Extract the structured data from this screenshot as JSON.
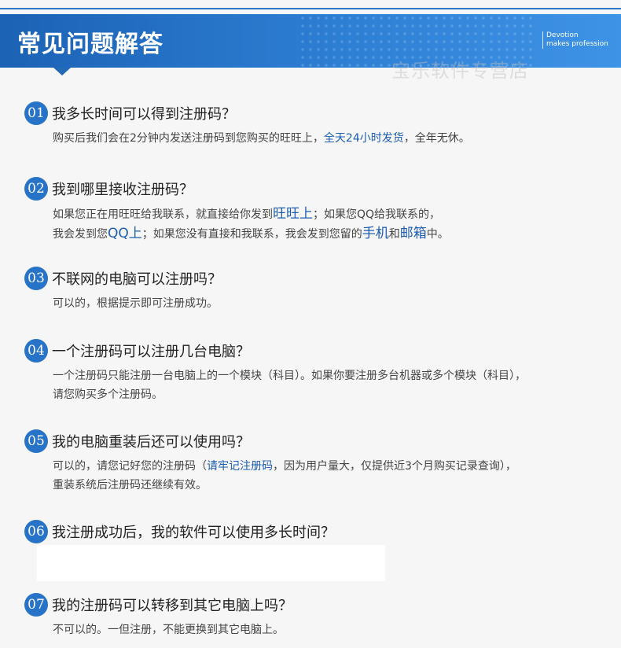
{
  "header": {
    "title": "常见问题解答",
    "sub_line1": "Devotion",
    "sub_line2": "makes profession",
    "watermark": "宝乐软件专营店"
  },
  "faq": [
    {
      "num": "01",
      "question": "我多长时间可以得到注册码？",
      "answer": {
        "p1": "购买后我们会在2分钟内发送注册码到您购买的旺旺上，",
        "h1": "全天24小时发货",
        "p2": "，全年无休。"
      }
    },
    {
      "num": "02",
      "question": "我到哪里接收注册码？",
      "answer": {
        "p1": "如果您正在用旺旺给我联系，就直接给你发到",
        "h1": "旺旺上",
        "p2": "；如果您QQ给我联系的，",
        "p3": "我会发到您",
        "h2": "QQ上",
        "p4": "；如果您没有直接和我联系，我会发到您留的",
        "h3": "手机",
        "p5": "和",
        "h4": "邮箱",
        "p6": "中。"
      }
    },
    {
      "num": "03",
      "question": "不联网的电脑可以注册吗？",
      "answer": {
        "p1": "可以的，根据提示即可注册成功。"
      }
    },
    {
      "num": "04",
      "question": "一个注册码可以注册几台电脑？",
      "answer": {
        "p1": "一个注册码只能注册一台电脑上的一个模块（科目）。如果你要注册多台机器或多个模块（科目），",
        "p2": "请您购买多个注册码。"
      }
    },
    {
      "num": "05",
      "question": "我的电脑重装后还可以使用吗？",
      "answer": {
        "p1": "可以的，请您记好您的注册码（",
        "h1": "请牢记注册码",
        "p2": "，因为用户量大，仅提供近3个月购买记录查询），",
        "p3": "重装系统后注册码还继续有效。"
      }
    },
    {
      "num": "06",
      "question": "我注册成功后，我的软件可以使用多长时间？"
    },
    {
      "num": "07",
      "question": "我的注册码可以转移到其它电脑上吗？",
      "answer": {
        "p1": "不可以的。一但注册，不能更换到其它电脑上。"
      }
    }
  ],
  "colors": {
    "header_blue": "#1c62b5",
    "badge_blue": "#2773c8",
    "highlight_blue": "#1c5db1"
  }
}
